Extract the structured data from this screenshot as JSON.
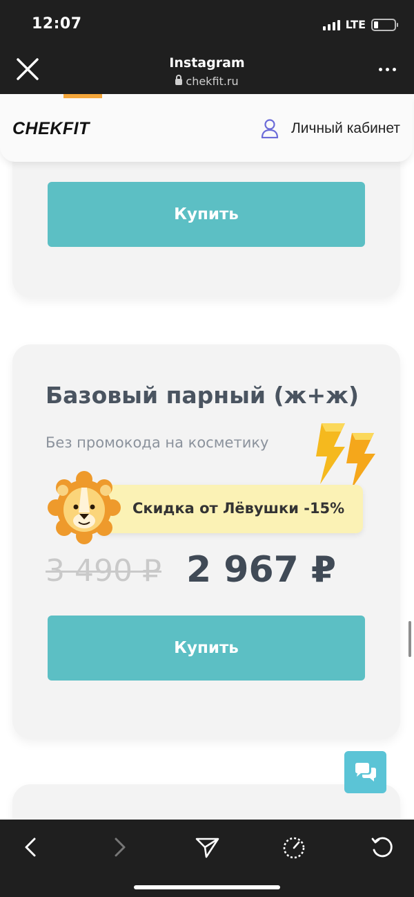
{
  "status_bar": {
    "time": "12:07",
    "network": "LTE"
  },
  "browser": {
    "title": "Instagram",
    "url": "chekfit.ru"
  },
  "site_header": {
    "logo": "CHEKFIT",
    "account_label": "Личный кабинет"
  },
  "cards": [
    {
      "buy_label": "Купить"
    },
    {
      "title": "Базовый парный (ж+ж)",
      "subtitle": "Без промокода на косметику",
      "discount_label": "Скидка от Лёвушки -15%",
      "old_price": "3 490 ₽",
      "new_price": "2 967 ₽",
      "buy_label": "Купить"
    }
  ],
  "colors": {
    "accent": "#5cbfc4",
    "chat": "#5bc4d6",
    "discount_bg": "#fbf2b5",
    "bar": "#1f1f1f"
  },
  "icons": [
    "close-icon",
    "lock-icon",
    "more-icon",
    "user-icon",
    "lightning-icon",
    "lion-icon",
    "chat-icon",
    "back-icon",
    "forward-icon",
    "share-icon",
    "speed-icon",
    "reload-icon"
  ]
}
